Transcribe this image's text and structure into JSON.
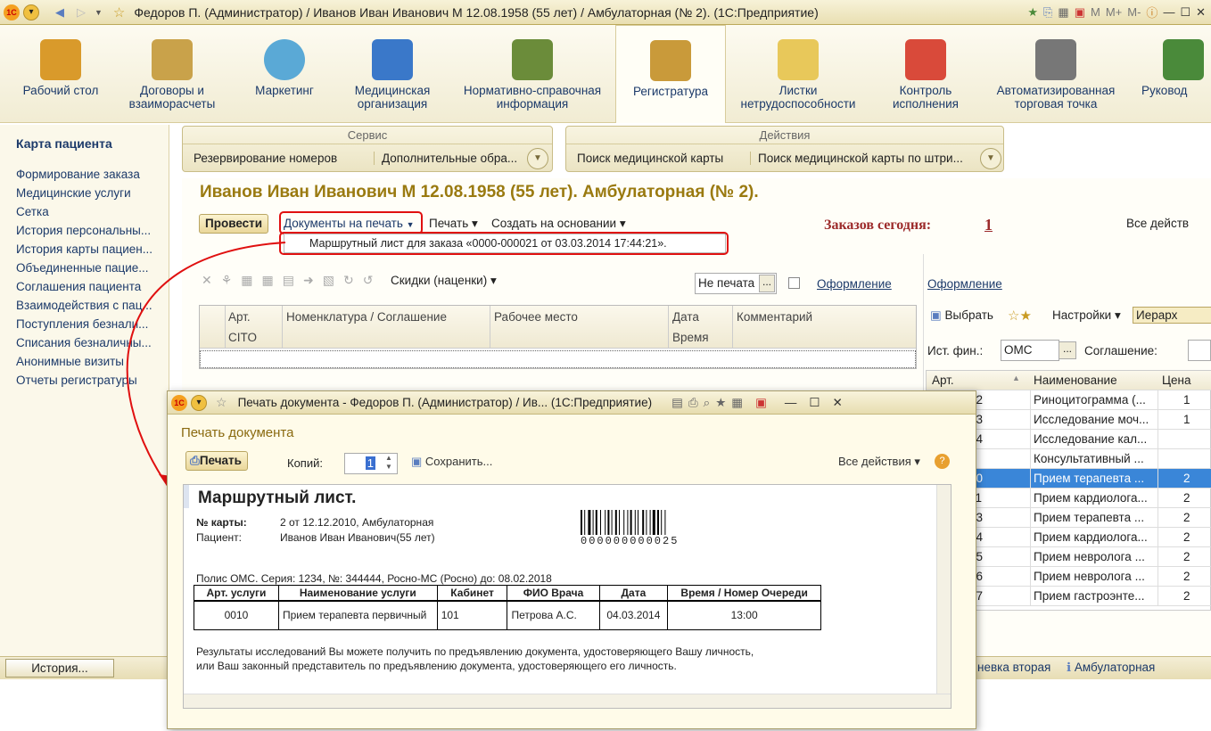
{
  "window": {
    "title": "Федоров П. (Администратор) / Иванов Иван Иванович М 12.08.1958 (55 лет) / Амбулаторная (№ 2).  (1С:Предприятие)",
    "right_tools": [
      "M",
      "M+",
      "M-"
    ]
  },
  "sections": [
    {
      "label": "Рабочий стол",
      "icon": "desk-icon",
      "color": "#d99a2b"
    },
    {
      "label": "Договоры и взаиморасчеты",
      "icon": "coins-icon",
      "color": "#c9a24a"
    },
    {
      "label": "Маркетинг",
      "icon": "piechart-icon",
      "color": "#5aa9d6"
    },
    {
      "label": "Медицинская организация",
      "icon": "building-icon",
      "color": "#3a78c9"
    },
    {
      "label": "Нормативно-справочная информация",
      "icon": "binders-icon",
      "color": "#6b8c3a"
    },
    {
      "label": "Регистратура",
      "icon": "clipboard-icon",
      "color": "#c99a3a"
    },
    {
      "label": "Листки нетрудоспособности",
      "icon": "sheets-icon",
      "color": "#e8c85a"
    },
    {
      "label": "Контроль исполнения",
      "icon": "medkit-icon",
      "color": "#d94a3a"
    },
    {
      "label": "Автоматизированная торговая точка",
      "icon": "register-icon",
      "color": "#777777"
    },
    {
      "label": "Руковод",
      "icon": "manager-icon",
      "color": "#4a8a3a"
    }
  ],
  "left_panel": {
    "title": "Карта пациента",
    "items": [
      "Формирование заказа",
      "Медицинские услуги",
      "Сетка",
      "История персональны...",
      "История карты пациен...",
      "Объединенные пацие...",
      "Соглашения пациента",
      "Взаимодействия с пац...",
      "Поступления безнали...",
      "Списания безналичны...",
      "Анонимные визиты",
      "Отчеты регистратуры"
    ]
  },
  "service_panel": {
    "header": "Сервис",
    "items": [
      "Резервирование номеров",
      "Дополнительные обра..."
    ]
  },
  "actions_panel": {
    "header": "Действия",
    "items": [
      "Поиск медицинской карты",
      "Поиск медицинской карты по штри..."
    ]
  },
  "main": {
    "heading": "Иванов Иван Иванович М 12.08.1958 (55 лет). Амбулаторная (№ 2).",
    "post_button": "Провести",
    "print_docs": "Документы на печать",
    "print": "Печать",
    "create_based": "Создать на основании",
    "orders_today_label": "Заказов сегодня:",
    "orders_today_value": "1",
    "all_actions": "Все действ",
    "dropdown_item": "Маршрутный лист для заказа «0000-000021 от 03.03.2014 17:44:21».",
    "discounts": "Скидки (наценки)",
    "print_status": "Не печата",
    "appearance1": "Оформление",
    "appearance2": "Оформление",
    "grid_headers": [
      "Арт.",
      "Номенклатура / Соглашение",
      "Рабочее место",
      "Дата",
      "Комментарий"
    ],
    "grid_subheaders": [
      "CITO",
      "Время"
    ]
  },
  "right_panel": {
    "select": "Выбрать",
    "settings": "Настройки",
    "hierarchy": "Иерарх",
    "fin_label": "Ист. фин.:",
    "fin_value": "ОМС",
    "agreement_label": "Соглашение:",
    "col_art": "Арт.",
    "col_name": "Наименование",
    "col_price": "Цена",
    "rows": [
      {
        "art": "32",
        "name": "Риноцитограмма (...",
        "price": "1",
        "selected": false
      },
      {
        "art": "33",
        "name": "Исследование моч...",
        "price": "1",
        "selected": false
      },
      {
        "art": "34",
        "name": "Исследование кал...",
        "price": "",
        "selected": false
      },
      {
        "art": "",
        "name": "Консультативный ...",
        "price": "",
        "selected": false
      },
      {
        "art": "10",
        "name": "Прием терапевта ...",
        "price": "2",
        "selected": true
      },
      {
        "art": "11",
        "name": "Прием кардиолога...",
        "price": "2",
        "selected": false
      },
      {
        "art": "13",
        "name": "Прием терапевта ...",
        "price": "2",
        "selected": false
      },
      {
        "art": "14",
        "name": "Прием кардиолога...",
        "price": "2",
        "selected": false
      },
      {
        "art": "15",
        "name": "Прием невролога ...",
        "price": "2",
        "selected": false
      },
      {
        "art": "16",
        "name": "Прием невролога ...",
        "price": "2",
        "selected": false
      },
      {
        "art": "17",
        "name": "Прием гастроэнте...",
        "price": "2",
        "selected": false
      }
    ]
  },
  "statusbar": {
    "history": "История...",
    "right1": "невка вторая",
    "right2": "Амбулаторная"
  },
  "dialog": {
    "title": "Печать документа - Федоров П. (Администратор) / Ив...  (1С:Предприятие)",
    "heading": "Печать документа",
    "print_button": "Печать",
    "copies_label": "Копий:",
    "copies_value": "1",
    "save": "Сохранить...",
    "all_actions": "Все действия",
    "doc": {
      "title": "Маршрутный лист.",
      "card_label": "№ карты:",
      "card_value": "2 от 12.12.2010, Амбулаторная",
      "patient_label": "Пациент:",
      "patient_value": "Иванов Иван Иванович(55 лет)",
      "barcode": "000000000025",
      "policy": "Полис ОМС. Серия: 1234, №: 344444, Росно-МС (Росно) до: 08.02.2018",
      "table_headers": [
        "Арт. услуги",
        "Наименование услуги",
        "Кабинет",
        "ФИО Врача",
        "Дата",
        "Время / Номер Очереди"
      ],
      "row": [
        "0010",
        "Прием терапевта первичный",
        "101",
        "Петрова А.С.",
        "04.03.2014",
        "13:00"
      ],
      "footer1": "Результаты исследований Вы можете получить по предъявлению документа, удостоверяющего Вашу личность,",
      "footer2": "или Ваш законный представитель по предъявлению документа, удостоверяющего его личность."
    }
  }
}
